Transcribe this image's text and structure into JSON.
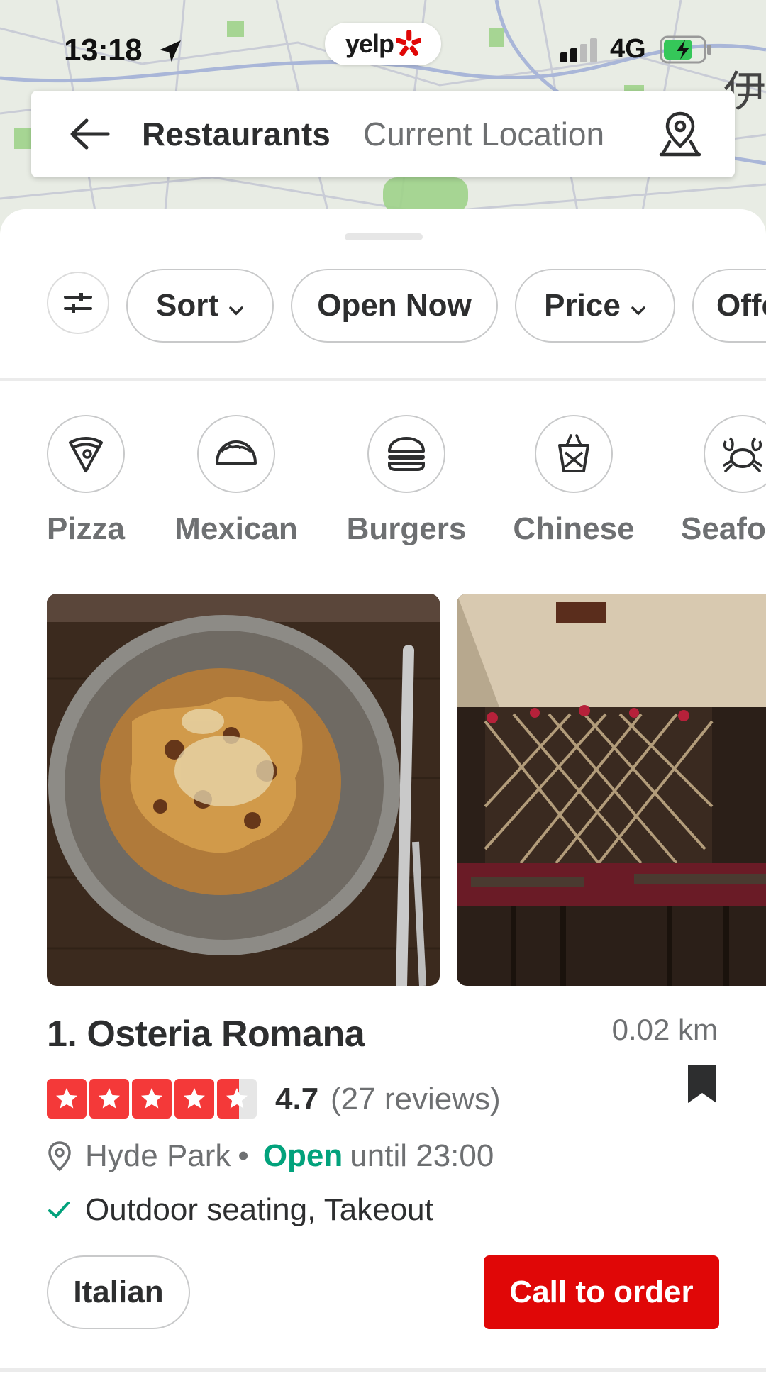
{
  "status_bar": {
    "time": "13:18",
    "network": "4G",
    "brand_logo": "yelp"
  },
  "search": {
    "term": "Restaurants",
    "location": "Current Location"
  },
  "filters": {
    "sort_label": "Sort",
    "open_now_label": "Open Now",
    "price_label": "Price",
    "offers_label": "Offe"
  },
  "categories": [
    {
      "label": "Pizza",
      "icon": "pizza-icon"
    },
    {
      "label": "Mexican",
      "icon": "taco-icon"
    },
    {
      "label": "Burgers",
      "icon": "burger-icon"
    },
    {
      "label": "Chinese",
      "icon": "takeout-box-icon"
    },
    {
      "label": "Seafo",
      "icon": "crab-icon"
    }
  ],
  "listing": {
    "name": "1. Osteria Romana",
    "distance": "0.02 km",
    "rating": 4.7,
    "rating_text": "4.7",
    "reviews_text": "(27 reviews)",
    "neighborhood": "Hyde Park",
    "separator": "•",
    "open_status": "Open",
    "hours_text": "until 23:00",
    "amenities": "Outdoor seating, Takeout",
    "category_tag": "Italian",
    "cta_label": "Call to order",
    "stars_filled_fraction": 0.94
  },
  "colors": {
    "brand_red": "#e00707",
    "star_red": "#f43939",
    "open_green": "#02a27c",
    "text_primary": "#2d2e2f",
    "text_secondary": "#6e7072"
  }
}
